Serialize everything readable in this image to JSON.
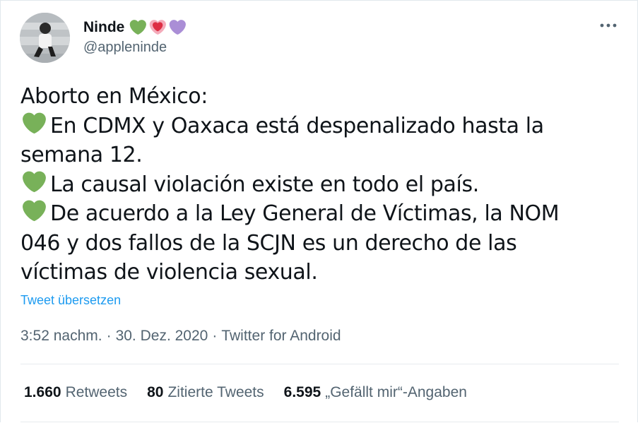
{
  "user": {
    "display_name": "Ninde",
    "handle": "@appleninde",
    "name_emojis": [
      "green-heart",
      "sparkling-heart",
      "purple-heart"
    ]
  },
  "more_icon": "more-horizontal-icon",
  "tweet": {
    "lines": [
      {
        "emoji": false,
        "text": "Aborto en México:"
      },
      {
        "emoji": true,
        "text": "En CDMX y Oaxaca está despenalizado hasta la"
      },
      {
        "emoji": false,
        "text": "semana 12."
      },
      {
        "emoji": true,
        "text": "La causal violación existe en todo el país."
      },
      {
        "emoji": true,
        "text": "De acuerdo a la Ley General de Víctimas, la NOM"
      },
      {
        "emoji": false,
        "text": "046 y dos fallos de la SCJN es un derecho de las"
      },
      {
        "emoji": false,
        "text": "víctimas de violencia sexual."
      }
    ],
    "translate_label": "Tweet übersetzen"
  },
  "meta": {
    "time": "3:52 nachm.",
    "date": "30. Dez. 2020",
    "source": "Twitter for Android",
    "separator": "·"
  },
  "stats": {
    "retweets_count": "1.660",
    "retweets_label": "Retweets",
    "quotes_count": "80",
    "quotes_label": "Zitierte Tweets",
    "likes_count": "6.595",
    "likes_label": "„Gefällt mir“-Angaben"
  },
  "colors": {
    "link": "#1d9bf0",
    "secondary_text": "#536471",
    "green_heart": "#78b159",
    "pink_heart": "#f4abba",
    "purple_heart": "#aa8ed6"
  }
}
